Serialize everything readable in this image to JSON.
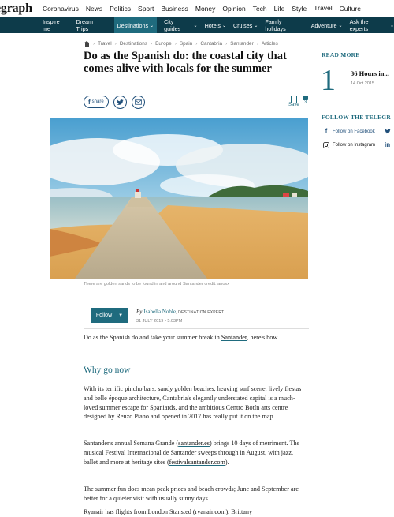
{
  "brand": {
    "logo_text": "egraph"
  },
  "top_nav": [
    "Coronavirus",
    "News",
    "Politics",
    "Sport",
    "Business",
    "Money",
    "Opinion",
    "Tech",
    "Life",
    "Style",
    "Travel",
    "Culture"
  ],
  "top_nav_active": "Travel",
  "sub_nav": [
    {
      "label": "Inspire me",
      "dropdown": false
    },
    {
      "label": "Dream Trips",
      "dropdown": false
    },
    {
      "label": "Destinations",
      "dropdown": true,
      "active": true
    },
    {
      "label": "City guides",
      "dropdown": true
    },
    {
      "label": "Hotels",
      "dropdown": true
    },
    {
      "label": "Cruises",
      "dropdown": true
    },
    {
      "label": "Family holidays",
      "dropdown": false
    },
    {
      "label": "Adventure",
      "dropdown": true
    },
    {
      "label": "Ask the experts",
      "dropdown": true
    }
  ],
  "breadcrumb": [
    "Travel",
    "Destinations",
    "Europe",
    "Spain",
    "Cantabria",
    "Santander",
    "Articles"
  ],
  "article": {
    "headline": "Do as the Spanish do: the coastal city that comes alive with locals for the summer",
    "share_label": "share",
    "save_label": "Save",
    "comment_count": "3",
    "image_caption": "There are golden sands to be found in and around Santander  credit: anoxx",
    "follow_label": "Follow",
    "byline_by": "By",
    "author": "Isabella Noble",
    "author_role": "DESTINATION EXPERT",
    "date": "31 JULY 2019 • 5:03PM",
    "intro_before": "Do as the Spanish do and take your summer break in ",
    "intro_link": "Santander",
    "intro_after": ", here's how.",
    "section_heading": "Why go now",
    "p1": "With its terrific pincho bars, sandy golden beaches, heaving surf scene, lively fiestas and belle époque architecture, Cantabria's elegantly understated capital is a much-loved summer escape for Spaniards, and the ambitious Centro Botín arts centre designed by Renzo Piano and opened in 2017 has really put it on the map.",
    "p2_a": "Santander's annual Semana Grande (",
    "p2_link1": "santander.es",
    "p2_b": ") brings 10 days of merriment. The musical Festival Internacional de Santander sweeps through in August, with jazz, ballet and more at heritage sites (",
    "p2_link2": "festivalsantander.com",
    "p2_c": ").",
    "p3": "The summer fun does mean peak prices and beach crowds; June and September are better for a quieter visit with usually sunny days.",
    "p4_a": "Ryanair has flights from London Stansted (",
    "p4_link": "ryanair.com",
    "p4_b": "). Brittany"
  },
  "sidebar": {
    "read_more_heading": "READ MORE",
    "item_number": "1",
    "item_title": "36 Hours in...",
    "item_date": "14 Oct 2015",
    "follow_heading": "FOLLOW THE TELEGR",
    "facebook_label": "Follow on Facebook",
    "instagram_label": "Follow on Instagram"
  },
  "colors": {
    "accent": "#1f6b7e",
    "subnav_bg": "#0d3b4a",
    "link_blue": "#1f4e79"
  }
}
